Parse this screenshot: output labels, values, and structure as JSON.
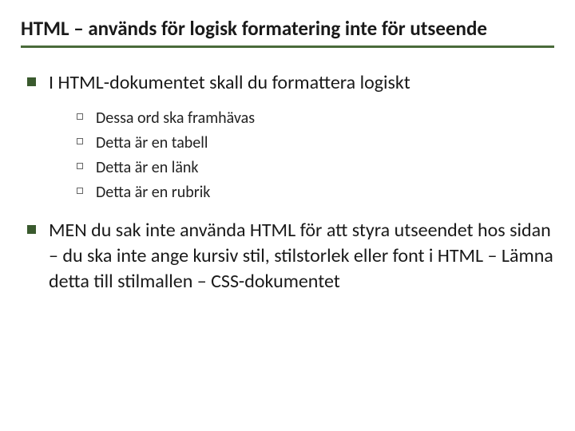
{
  "title": "HTML – används för logisk formatering inte för utseende",
  "main": {
    "b1": "I HTML-dokumentet skall du formattera logiskt",
    "sub": {
      "s1": "Dessa ord ska framhävas",
      "s2": "Detta är en tabell",
      "s3": "Detta är en länk",
      "s4": "Detta är en rubrik"
    },
    "b2": "MEN du sak inte använda HTML för att styra utseendet hos sidan – du ska inte ange kursiv stil, stilstorlek eller font i HTML – Lämna detta till stilmallen – CSS-dokumentet"
  }
}
